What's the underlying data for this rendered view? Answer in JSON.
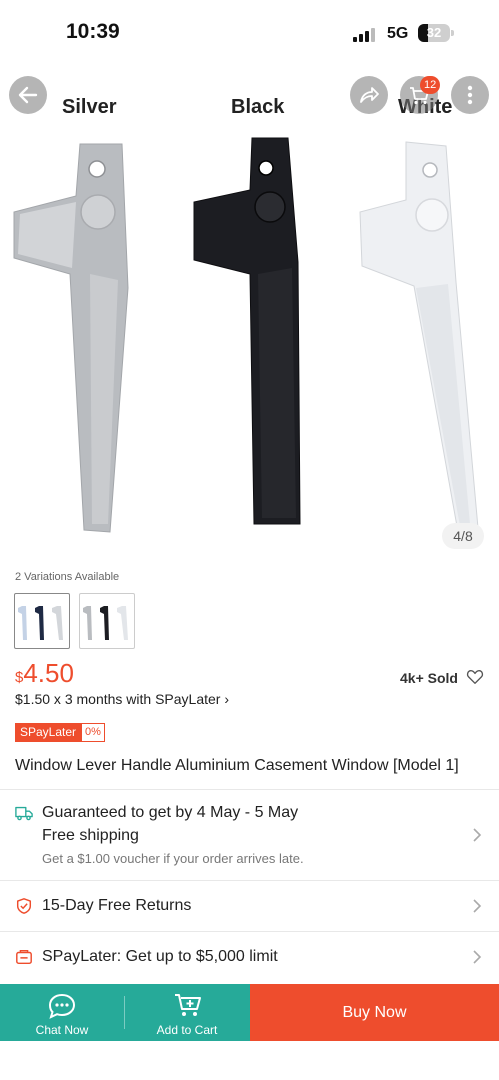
{
  "status_bar": {
    "time": "10:39",
    "network": "5G",
    "battery": "32",
    "battery_level": 0.32
  },
  "hero": {
    "color_labels": [
      "Silver",
      "Black",
      "White"
    ],
    "cart_count": "12",
    "image_counter": "4/8"
  },
  "variations": {
    "label": "2 Variations Available"
  },
  "price": {
    "currency": "$",
    "amount": "4.50",
    "sold": "4k+ Sold",
    "installment": "$1.50 x 3 months with SPayLater ›",
    "tag_label": "SPayLater",
    "tag_rate": "0%"
  },
  "product": {
    "title": "Window Lever Handle Aluminium Casement Window [Model 1]"
  },
  "shipping": {
    "guarantee": "Guaranteed to get by 4 May - 5 May",
    "free": "Free shipping",
    "voucher": "Get a $1.00 voucher if your order arrives late."
  },
  "returns": {
    "label": "15-Day Free Returns"
  },
  "spaylater": {
    "label": "SPayLater: Get up to $5,000 limit"
  },
  "bottom_bar": {
    "chat": "Chat Now",
    "cart": "Add to Cart",
    "buy": "Buy Now"
  },
  "colors": {
    "accent": "#ee4d2d",
    "teal": "#26aa99"
  }
}
